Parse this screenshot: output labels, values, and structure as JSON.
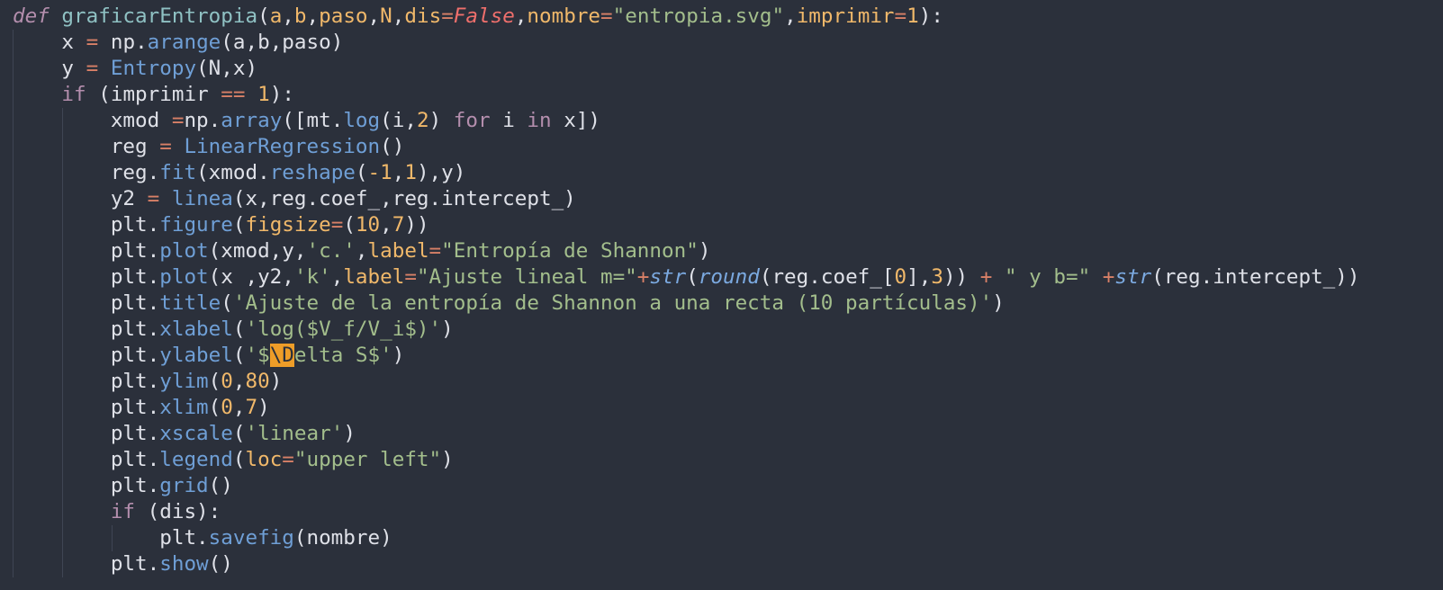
{
  "colors": {
    "background": "#2b303b",
    "keyword": "#b48ead",
    "function": "#8fc1c3",
    "parameter": "#f0b86a",
    "string": "#a3be8c",
    "method": "#6f9fd6",
    "selection": "#ee9d28"
  },
  "editor": {
    "lines": [
      {
        "indent": 0,
        "tokens": [
          {
            "t": "def",
            "c": "def"
          },
          {
            "t": " ",
            "c": "plain"
          },
          {
            "t": "graficarEntropia",
            "c": "fn"
          },
          {
            "t": "(",
            "c": "plain"
          },
          {
            "t": "a",
            "c": "param"
          },
          {
            "t": ",",
            "c": "plain"
          },
          {
            "t": "b",
            "c": "param"
          },
          {
            "t": ",",
            "c": "plain"
          },
          {
            "t": "paso",
            "c": "param"
          },
          {
            "t": ",",
            "c": "plain"
          },
          {
            "t": "N",
            "c": "param"
          },
          {
            "t": ",",
            "c": "plain"
          },
          {
            "t": "dis",
            "c": "param"
          },
          {
            "t": "=",
            "c": "opv"
          },
          {
            "t": "False",
            "c": "const"
          },
          {
            "t": ",",
            "c": "plain"
          },
          {
            "t": "nombre",
            "c": "param"
          },
          {
            "t": "=",
            "c": "opv"
          },
          {
            "t": "\"entropia.svg\"",
            "c": "str"
          },
          {
            "t": ",",
            "c": "plain"
          },
          {
            "t": "imprimir",
            "c": "param"
          },
          {
            "t": "=",
            "c": "opv"
          },
          {
            "t": "1",
            "c": "num"
          },
          {
            "t": "):",
            "c": "plain"
          }
        ]
      },
      {
        "indent": 1,
        "tokens": [
          {
            "t": "x ",
            "c": "plain"
          },
          {
            "t": "=",
            "c": "opv"
          },
          {
            "t": " np",
            "c": "plain"
          },
          {
            "t": ".",
            "c": "plain"
          },
          {
            "t": "arange",
            "c": "meth"
          },
          {
            "t": "(a,b,paso)",
            "c": "plain"
          }
        ]
      },
      {
        "indent": 1,
        "tokens": [
          {
            "t": "y ",
            "c": "plain"
          },
          {
            "t": "=",
            "c": "opv"
          },
          {
            "t": " ",
            "c": "plain"
          },
          {
            "t": "Entropy",
            "c": "meth"
          },
          {
            "t": "(N,x)",
            "c": "plain"
          }
        ]
      },
      {
        "indent": 1,
        "tokens": [
          {
            "t": "if",
            "c": "kw"
          },
          {
            "t": " (imprimir ",
            "c": "plain"
          },
          {
            "t": "==",
            "c": "opv"
          },
          {
            "t": " ",
            "c": "plain"
          },
          {
            "t": "1",
            "c": "num"
          },
          {
            "t": "):",
            "c": "plain"
          }
        ]
      },
      {
        "indent": 2,
        "tokens": [
          {
            "t": "xmod ",
            "c": "plain"
          },
          {
            "t": "=",
            "c": "opv"
          },
          {
            "t": "np",
            "c": "plain"
          },
          {
            "t": ".",
            "c": "plain"
          },
          {
            "t": "array",
            "c": "meth"
          },
          {
            "t": "([mt",
            "c": "plain"
          },
          {
            "t": ".",
            "c": "plain"
          },
          {
            "t": "log",
            "c": "meth"
          },
          {
            "t": "(i,",
            "c": "plain"
          },
          {
            "t": "2",
            "c": "num"
          },
          {
            "t": ") ",
            "c": "plain"
          },
          {
            "t": "for",
            "c": "kw"
          },
          {
            "t": " i ",
            "c": "plain"
          },
          {
            "t": "in",
            "c": "kw"
          },
          {
            "t": " x])",
            "c": "plain"
          }
        ]
      },
      {
        "indent": 2,
        "tokens": [
          {
            "t": "reg ",
            "c": "plain"
          },
          {
            "t": "=",
            "c": "opv"
          },
          {
            "t": " ",
            "c": "plain"
          },
          {
            "t": "LinearRegression",
            "c": "meth"
          },
          {
            "t": "()",
            "c": "plain"
          }
        ]
      },
      {
        "indent": 2,
        "tokens": [
          {
            "t": "reg",
            "c": "plain"
          },
          {
            "t": ".",
            "c": "plain"
          },
          {
            "t": "fit",
            "c": "meth"
          },
          {
            "t": "(xmod",
            "c": "plain"
          },
          {
            "t": ".",
            "c": "plain"
          },
          {
            "t": "reshape",
            "c": "meth"
          },
          {
            "t": "(",
            "c": "plain"
          },
          {
            "t": "-1",
            "c": "num"
          },
          {
            "t": ",",
            "c": "plain"
          },
          {
            "t": "1",
            "c": "num"
          },
          {
            "t": "),y)",
            "c": "plain"
          }
        ]
      },
      {
        "indent": 2,
        "tokens": [
          {
            "t": "y2 ",
            "c": "plain"
          },
          {
            "t": "=",
            "c": "opv"
          },
          {
            "t": " ",
            "c": "plain"
          },
          {
            "t": "linea",
            "c": "meth"
          },
          {
            "t": "(x,reg",
            "c": "plain"
          },
          {
            "t": ".",
            "c": "plain"
          },
          {
            "t": "coef_,reg",
            "c": "plain"
          },
          {
            "t": ".",
            "c": "plain"
          },
          {
            "t": "intercept_)",
            "c": "plain"
          }
        ]
      },
      {
        "indent": 2,
        "tokens": [
          {
            "t": "plt",
            "c": "plain"
          },
          {
            "t": ".",
            "c": "plain"
          },
          {
            "t": "figure",
            "c": "meth"
          },
          {
            "t": "(",
            "c": "plain"
          },
          {
            "t": "figsize",
            "c": "param"
          },
          {
            "t": "=",
            "c": "opv"
          },
          {
            "t": "(",
            "c": "plain"
          },
          {
            "t": "10",
            "c": "num"
          },
          {
            "t": ",",
            "c": "plain"
          },
          {
            "t": "7",
            "c": "num"
          },
          {
            "t": "))",
            "c": "plain"
          }
        ]
      },
      {
        "indent": 2,
        "tokens": [
          {
            "t": "plt",
            "c": "plain"
          },
          {
            "t": ".",
            "c": "plain"
          },
          {
            "t": "plot",
            "c": "meth"
          },
          {
            "t": "(xmod,y,",
            "c": "plain"
          },
          {
            "t": "'c.'",
            "c": "str"
          },
          {
            "t": ",",
            "c": "plain"
          },
          {
            "t": "label",
            "c": "param"
          },
          {
            "t": "=",
            "c": "opv"
          },
          {
            "t": "\"Entropía de Shannon\"",
            "c": "str"
          },
          {
            "t": ")",
            "c": "plain"
          }
        ]
      },
      {
        "indent": 2,
        "tokens": [
          {
            "t": "plt",
            "c": "plain"
          },
          {
            "t": ".",
            "c": "plain"
          },
          {
            "t": "plot",
            "c": "meth"
          },
          {
            "t": "(x ,y2,",
            "c": "plain"
          },
          {
            "t": "'k'",
            "c": "str"
          },
          {
            "t": ",",
            "c": "plain"
          },
          {
            "t": "label",
            "c": "param"
          },
          {
            "t": "=",
            "c": "opv"
          },
          {
            "t": "\"Ajuste lineal m=\"",
            "c": "str"
          },
          {
            "t": "+",
            "c": "opv"
          },
          {
            "t": "str",
            "c": "builtin"
          },
          {
            "t": "(",
            "c": "plain"
          },
          {
            "t": "round",
            "c": "builtin"
          },
          {
            "t": "(reg",
            "c": "plain"
          },
          {
            "t": ".",
            "c": "plain"
          },
          {
            "t": "coef_[",
            "c": "plain"
          },
          {
            "t": "0",
            "c": "num"
          },
          {
            "t": "],",
            "c": "plain"
          },
          {
            "t": "3",
            "c": "num"
          },
          {
            "t": ")) ",
            "c": "plain"
          },
          {
            "t": "+",
            "c": "opv"
          },
          {
            "t": " ",
            "c": "plain"
          },
          {
            "t": "\" y b=\"",
            "c": "str"
          },
          {
            "t": " ",
            "c": "plain"
          },
          {
            "t": "+",
            "c": "opv"
          },
          {
            "t": "str",
            "c": "builtin"
          },
          {
            "t": "(reg",
            "c": "plain"
          },
          {
            "t": ".",
            "c": "plain"
          },
          {
            "t": "intercept_))",
            "c": "plain"
          }
        ]
      },
      {
        "indent": 2,
        "tokens": [
          {
            "t": "plt",
            "c": "plain"
          },
          {
            "t": ".",
            "c": "plain"
          },
          {
            "t": "title",
            "c": "meth"
          },
          {
            "t": "(",
            "c": "plain"
          },
          {
            "t": "'Ajuste de la entropía de Shannon a una recta (10 partículas)'",
            "c": "str"
          },
          {
            "t": ")",
            "c": "plain"
          }
        ]
      },
      {
        "indent": 2,
        "tokens": [
          {
            "t": "plt",
            "c": "plain"
          },
          {
            "t": ".",
            "c": "plain"
          },
          {
            "t": "xlabel",
            "c": "meth"
          },
          {
            "t": "(",
            "c": "plain"
          },
          {
            "t": "'log($V_f/V_i$)'",
            "c": "str"
          },
          {
            "t": ")",
            "c": "plain"
          }
        ]
      },
      {
        "indent": 2,
        "tokens": [
          {
            "t": "plt",
            "c": "plain"
          },
          {
            "t": ".",
            "c": "plain"
          },
          {
            "t": "ylabel",
            "c": "meth"
          },
          {
            "t": "(",
            "c": "plain"
          },
          {
            "t": "'$",
            "c": "str"
          },
          {
            "t": "\\D",
            "c": "sel"
          },
          {
            "t": "elta S$'",
            "c": "str"
          },
          {
            "t": ")",
            "c": "plain"
          }
        ]
      },
      {
        "indent": 2,
        "tokens": [
          {
            "t": "plt",
            "c": "plain"
          },
          {
            "t": ".",
            "c": "plain"
          },
          {
            "t": "ylim",
            "c": "meth"
          },
          {
            "t": "(",
            "c": "plain"
          },
          {
            "t": "0",
            "c": "num"
          },
          {
            "t": ",",
            "c": "plain"
          },
          {
            "t": "80",
            "c": "num"
          },
          {
            "t": ")",
            "c": "plain"
          }
        ]
      },
      {
        "indent": 2,
        "tokens": [
          {
            "t": "plt",
            "c": "plain"
          },
          {
            "t": ".",
            "c": "plain"
          },
          {
            "t": "xlim",
            "c": "meth"
          },
          {
            "t": "(",
            "c": "plain"
          },
          {
            "t": "0",
            "c": "num"
          },
          {
            "t": ",",
            "c": "plain"
          },
          {
            "t": "7",
            "c": "num"
          },
          {
            "t": ")",
            "c": "plain"
          }
        ]
      },
      {
        "indent": 2,
        "tokens": [
          {
            "t": "plt",
            "c": "plain"
          },
          {
            "t": ".",
            "c": "plain"
          },
          {
            "t": "xscale",
            "c": "meth"
          },
          {
            "t": "(",
            "c": "plain"
          },
          {
            "t": "'linear'",
            "c": "str"
          },
          {
            "t": ")",
            "c": "plain"
          }
        ]
      },
      {
        "indent": 2,
        "tokens": [
          {
            "t": "plt",
            "c": "plain"
          },
          {
            "t": ".",
            "c": "plain"
          },
          {
            "t": "legend",
            "c": "meth"
          },
          {
            "t": "(",
            "c": "plain"
          },
          {
            "t": "loc",
            "c": "param"
          },
          {
            "t": "=",
            "c": "opv"
          },
          {
            "t": "\"upper left\"",
            "c": "str"
          },
          {
            "t": ")",
            "c": "plain"
          }
        ]
      },
      {
        "indent": 2,
        "tokens": [
          {
            "t": "plt",
            "c": "plain"
          },
          {
            "t": ".",
            "c": "plain"
          },
          {
            "t": "grid",
            "c": "meth"
          },
          {
            "t": "()",
            "c": "plain"
          }
        ]
      },
      {
        "indent": 2,
        "tokens": [
          {
            "t": "if",
            "c": "kw"
          },
          {
            "t": " (dis):",
            "c": "plain"
          }
        ]
      },
      {
        "indent": 3,
        "tokens": [
          {
            "t": "plt",
            "c": "plain"
          },
          {
            "t": ".",
            "c": "plain"
          },
          {
            "t": "savefig",
            "c": "meth"
          },
          {
            "t": "(nombre)",
            "c": "plain"
          }
        ]
      },
      {
        "indent": 2,
        "tokens": [
          {
            "t": "plt",
            "c": "plain"
          },
          {
            "t": ".",
            "c": "plain"
          },
          {
            "t": "show",
            "c": "meth"
          },
          {
            "t": "()",
            "c": "plain"
          }
        ]
      }
    ]
  }
}
